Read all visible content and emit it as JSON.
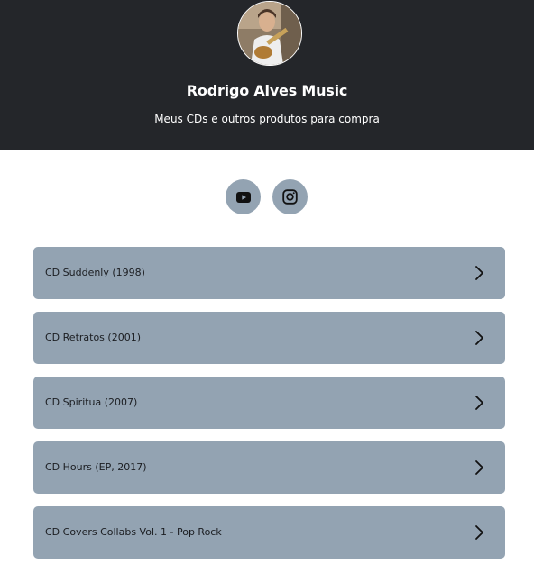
{
  "profile": {
    "name": "Rodrigo Alves Music",
    "description": "Meus CDs e outros produtos para compra",
    "avatar_icon": "avatar-photo"
  },
  "social": [
    {
      "icon": "youtube-icon",
      "label": "YouTube"
    },
    {
      "icon": "instagram-icon",
      "label": "Instagram"
    }
  ],
  "links": [
    {
      "label": "CD Suddenly (1998)"
    },
    {
      "label": "CD Retratos (2001)"
    },
    {
      "label": "CD Spiritua (2007)"
    },
    {
      "label": "CD Hours (EP, 2017)"
    },
    {
      "label": "CD Covers Collabs Vol. 1 - Pop Rock"
    }
  ],
  "colors": {
    "header_bg": "#24262a",
    "card_bg": "#93a3b2",
    "text_dark": "#1b1d21"
  }
}
